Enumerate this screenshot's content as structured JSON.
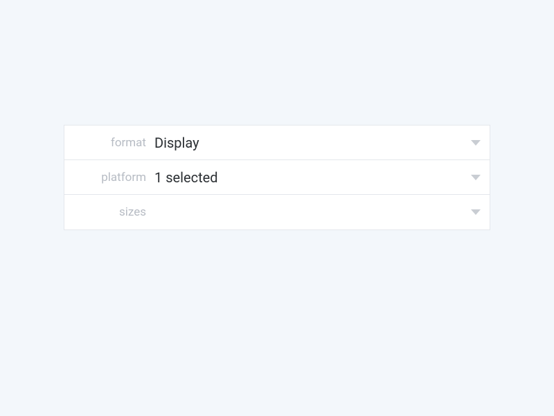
{
  "rows": [
    {
      "label": "format",
      "value": "Display"
    },
    {
      "label": "platform",
      "value": "1 selected"
    },
    {
      "label": "sizes",
      "value": ""
    }
  ]
}
